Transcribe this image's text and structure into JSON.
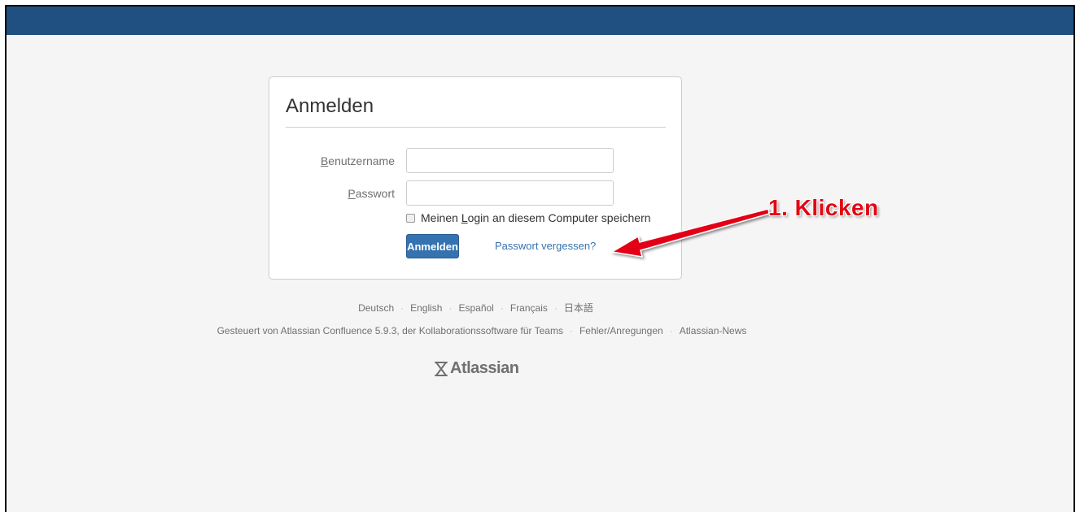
{
  "colors": {
    "topbar": "#205081",
    "primary_button": "#3572b0",
    "link": "#3572b0",
    "annotation": "#e30613"
  },
  "login": {
    "title": "Anmelden",
    "username_label_accesskey": "B",
    "username_label_rest": "enutzername",
    "username_value": "",
    "password_label_accesskey": "P",
    "password_label_rest": "asswort",
    "password_value": "",
    "remember_checked": false,
    "remember_before": "Meinen ",
    "remember_accesskey": "L",
    "remember_after": "ogin an diesem Computer speichern",
    "submit_label": "Anmelden",
    "forgot_link": "Passwort vergessen?"
  },
  "languages": [
    "Deutsch",
    "English",
    "Español",
    "Français",
    "日本語"
  ],
  "footer": {
    "powered_by": "Gesteuert von Atlassian Confluence 5.9.3, der Kollaborationssoftware für Teams",
    "report_link": "Fehler/Anregungen",
    "news_link": "Atlassian-News"
  },
  "logo": {
    "text": "Atlassian",
    "icon": "atlassian-icon"
  },
  "annotation": {
    "text": "1. Klicken",
    "icon": "red-arrow-icon"
  }
}
